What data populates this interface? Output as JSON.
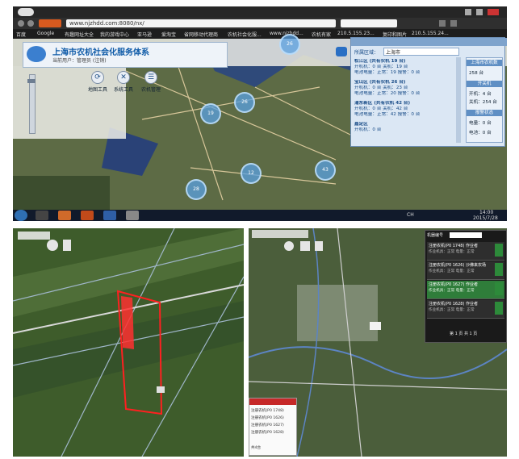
{
  "browser": {
    "url": "www.njzhdd.com:8080/nx/",
    "bookmarks": [
      "百度",
      "Google",
      "有趣网址大全",
      "我的游戏中心",
      "亚马逊",
      "爱淘宝",
      "省网移动代理商",
      "农机社会化服...",
      "www.njzhdd...",
      "农机有家",
      "210.5.155.23...",
      "复印和图片",
      "210.5.155.24..."
    ]
  },
  "app": {
    "title": "上海市农机社会化服务体系",
    "user_line": "当前用户：管理员 (注销)",
    "tools": [
      "地图工具",
      "系统工具",
      "农机管理"
    ]
  },
  "map_clusters": [
    "26",
    "26",
    "43",
    "28",
    "12",
    "19"
  ],
  "panel": {
    "region_label": "所属区域：",
    "region_value": "上海市",
    "districts": [
      {
        "name": "松江区 (共有农机 19 台)",
        "l1": "开机机：0 台  关机：19 台",
        "l2": "电池电量：正常：19  报警：0 台"
      },
      {
        "name": "宝山区 (共有农机 26 台)",
        "l1": "开机机：0 台  关机：23 台",
        "l2": "电池电量：正常：20  报警：0 台"
      },
      {
        "name": "浦东新区 (共有农机 42 台)",
        "l1": "开机机：0 台  关机：42 台",
        "l2": "电池电量：正常：42  报警：0 台"
      },
      {
        "name": "嘉定区",
        "l1": "开机机：0 台",
        "l2": ""
      }
    ],
    "summary": {
      "head1": "上海市农机数",
      "total": "258 台",
      "head2": "开关机",
      "on": "开机：4 台",
      "off": "关机：254 台",
      "head3": "报警状态",
      "alarm": "电量：0 台",
      "battery": "电池：0 台"
    }
  },
  "taskbar": {
    "lang": "CH",
    "time": "14:00",
    "date": "2015/7/28"
  },
  "right_panel": {
    "filter": "机器编号",
    "items": [
      {
        "name": "注册农机(P0 1748) 作业者",
        "detail": "作业机具：正常  电量：正常"
      },
      {
        "name": "注册农机(P0 1626) 沙佛来农场",
        "detail": "作业机具：正常  电量：正常"
      },
      {
        "name": "注册农机(P0 1627) 作业者",
        "detail": "作业机具：正常  电量：正常"
      },
      {
        "name": "注册农机(P0 1628) 作业者",
        "detail": "作业机具：正常  电量：正常"
      }
    ],
    "pager": "第 1 页 共 1 页"
  },
  "left_popup": {
    "items": [
      "注册农机(P0 1748)",
      "注册农机(P0 1626)",
      "注册农机(P0 1627)",
      "注册农机(P0 1628)"
    ],
    "footer": "共4台"
  }
}
